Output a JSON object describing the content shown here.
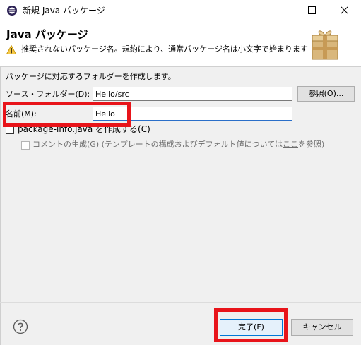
{
  "window": {
    "title": "新規 Java パッケージ",
    "controls": [
      "minimize",
      "maximize",
      "close"
    ]
  },
  "header": {
    "title": "Java パッケージ",
    "message": "推奨されないパッケージ名。規約により、通常パッケージ名は小文字で始まります",
    "message_icon": "warning-icon",
    "banner_icon": "package-wizard-icon"
  },
  "form": {
    "description": "パッケージに対応するフォルダーを作成します。",
    "source_folder_label": "ソース・フォルダー(D):",
    "source_folder_value": "Hello/src",
    "browse_label": "参照(O)...",
    "name_label": "名前(M):",
    "name_value": "Hello",
    "package_info": {
      "label": "package-info.java を作成する(C)",
      "checked": false
    },
    "comments": {
      "label_before": "コメントの生成(G) (テンプレートの構成およびデフォルト値については",
      "label_link": "ここ",
      "label_after": "を参照)",
      "checked": false,
      "enabled": false
    }
  },
  "footer": {
    "help_icon": "help-icon",
    "finish_label": "完了(F)",
    "cancel_label": "キャンセル"
  },
  "colors": {
    "highlight": "#e8141a",
    "focus": "#0078d7"
  }
}
